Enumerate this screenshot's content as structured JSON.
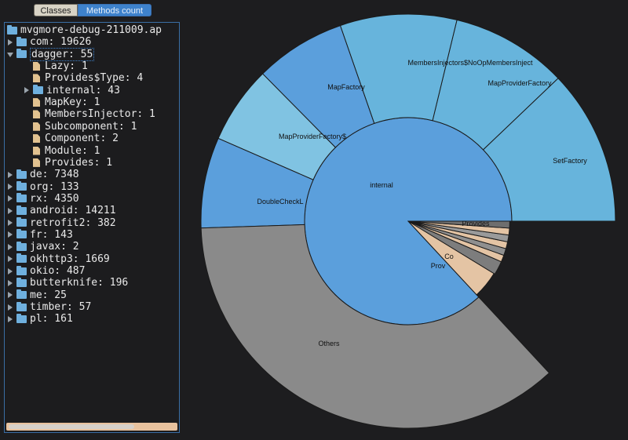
{
  "toolbar": {
    "classes_label": "Classes",
    "methods_label": "Methods count"
  },
  "tree": [
    {
      "label": "mvgmore-debug-211009.ap",
      "kind": "folder",
      "depth": 0,
      "toggle": "none"
    },
    {
      "label": "com: 19626",
      "kind": "folder",
      "depth": 0,
      "toggle": "right"
    },
    {
      "label": "dagger: 55",
      "kind": "folder",
      "depth": 0,
      "toggle": "down",
      "selected": true
    },
    {
      "label": "Lazy: 1",
      "kind": "file",
      "depth": 1,
      "toggle": "none"
    },
    {
      "label": "Provides$Type: 4",
      "kind": "file",
      "depth": 1,
      "toggle": "none"
    },
    {
      "label": "internal: 43",
      "kind": "folder",
      "depth": 1,
      "toggle": "right"
    },
    {
      "label": "MapKey: 1",
      "kind": "file",
      "depth": 1,
      "toggle": "none"
    },
    {
      "label": "MembersInjector: 1",
      "kind": "file",
      "depth": 1,
      "toggle": "none"
    },
    {
      "label": "Subcomponent: 1",
      "kind": "file",
      "depth": 1,
      "toggle": "none"
    },
    {
      "label": "Component: 2",
      "kind": "file",
      "depth": 1,
      "toggle": "none"
    },
    {
      "label": "Module: 1",
      "kind": "file",
      "depth": 1,
      "toggle": "none"
    },
    {
      "label": "Provides: 1",
      "kind": "file",
      "depth": 1,
      "toggle": "none"
    },
    {
      "label": "de: 7348",
      "kind": "folder",
      "depth": 0,
      "toggle": "right"
    },
    {
      "label": "org: 133",
      "kind": "folder",
      "depth": 0,
      "toggle": "right"
    },
    {
      "label": "rx: 4350",
      "kind": "folder",
      "depth": 0,
      "toggle": "right"
    },
    {
      "label": "android: 14211",
      "kind": "folder",
      "depth": 0,
      "toggle": "right"
    },
    {
      "label": "retrofit2: 382",
      "kind": "folder",
      "depth": 0,
      "toggle": "right"
    },
    {
      "label": "fr: 143",
      "kind": "folder",
      "depth": 0,
      "toggle": "right"
    },
    {
      "label": "javax: 2",
      "kind": "folder",
      "depth": 0,
      "toggle": "right"
    },
    {
      "label": "okhttp3: 1669",
      "kind": "folder",
      "depth": 0,
      "toggle": "right"
    },
    {
      "label": "okio: 487",
      "kind": "folder",
      "depth": 0,
      "toggle": "right"
    },
    {
      "label": "butterknife: 196",
      "kind": "folder",
      "depth": 0,
      "toggle": "right"
    },
    {
      "label": "me: 25",
      "kind": "folder",
      "depth": 0,
      "toggle": "right"
    },
    {
      "label": "timber: 57",
      "kind": "folder",
      "depth": 0,
      "toggle": "right"
    },
    {
      "label": "pl: 161",
      "kind": "folder",
      "depth": 0,
      "toggle": "right"
    }
  ],
  "sunburst": {
    "inner": [
      {
        "label": "internal",
        "value": 43,
        "color": "#5b9fdc"
      },
      {
        "label": "Provides$Type",
        "value": 4,
        "color": "#e4c4a4"
      },
      {
        "label": "Component",
        "value": 2,
        "color": "#7d7d7d"
      },
      {
        "label": "",
        "value": 1,
        "color": "#e4c4a4"
      },
      {
        "label": "",
        "value": 1,
        "color": "#8f8f8f"
      },
      {
        "label": "",
        "value": 1,
        "color": "#e4c4a4"
      },
      {
        "label": "",
        "value": 1,
        "color": "#9a9a9a"
      },
      {
        "label": "",
        "value": 1,
        "color": "#e4c4a4"
      },
      {
        "label": "Provides",
        "value": 1,
        "color": "#6e6e6e"
      }
    ],
    "outer": [
      {
        "label": "SetFactory",
        "value": 6,
        "color": "#67b4dc"
      },
      {
        "label": "MapProviderFactory",
        "value": 4.5,
        "color": "#67b4dc"
      },
      {
        "label": "MembersInjectors$NoOpMembersInjector",
        "value": 4.5,
        "color": "#67b4dc"
      },
      {
        "label": "MapFactory",
        "value": 3.5,
        "color": "#5b9fdc"
      },
      {
        "label": "MapProviderFactory$Builder",
        "value": 3.0,
        "color": "#80c3e2"
      },
      {
        "label": "DoubleCheckLazy",
        "value": 3.5,
        "color": "#5b9fdc"
      },
      {
        "label": "Others",
        "value": 18,
        "color": "#8a8a8a"
      }
    ]
  },
  "sunburst_labels": {
    "setfactory": "SetFactory",
    "mapproviderfactory": "MapProviderFactory",
    "membersinjectors": "MembersInjectors$NoOpMembersInject",
    "mapfactory": "MapFactory",
    "mapproviderfactory_builder": "MapProviderFactory$",
    "doublechecklazy": "DoubleCheckL",
    "others": "Others",
    "internal": "internal",
    "provides": "Provides",
    "providestype": "Prov",
    "component": "Co"
  }
}
